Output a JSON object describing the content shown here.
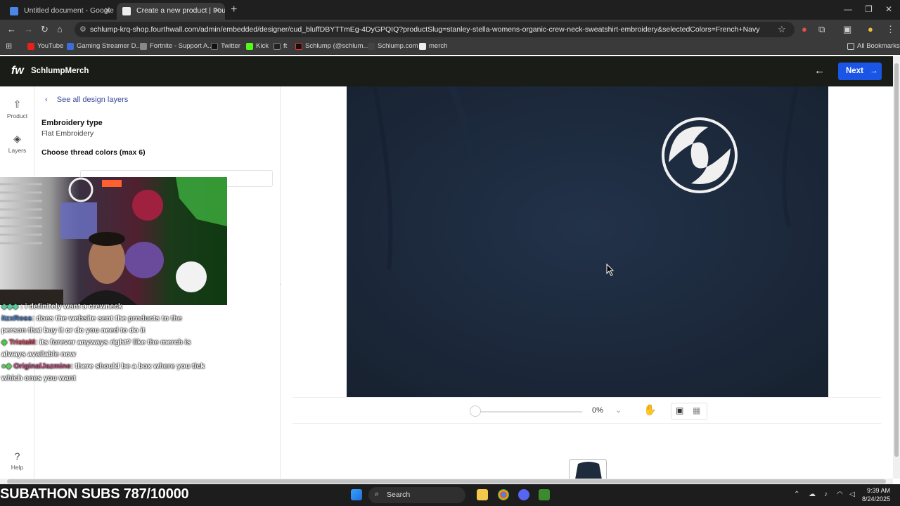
{
  "browser": {
    "tabs": [
      {
        "title": "Untitled document - Google Do",
        "active": false,
        "favicon": "docs-icon"
      },
      {
        "title": "Create a new product | Fourthw",
        "active": true,
        "favicon": "fourthwall-icon"
      }
    ],
    "url": "schlump-krq-shop.fourthwall.com/admin/embedded/designer/cud_bluffDBYTTmEg-4DyGPQIQ?productSlug=stanley-stella-womens-organic-crew-neck-sweatshirt-embroidery&selectedColors=French+Navy",
    "bookmarks": [
      "YouTube",
      "Gaming Streamer D...",
      "Fortnite - Support A...",
      "Twitter",
      "Kick",
      "ft",
      "Schlump (@schlum...",
      "Schlump.com",
      "merch"
    ],
    "all_bookmarks": "All Bookmarks"
  },
  "app": {
    "logo": "fw",
    "shop_name": "SchlumpMerch",
    "next_label": "Next",
    "accent": "#1a55e6"
  },
  "rail": {
    "product": "Product",
    "layers": "Layers",
    "help": "Help"
  },
  "panel": {
    "see_all": "See all design layers",
    "embroidery_type_label": "Embroidery type",
    "embroidery_type_value": "Flat Embroidery",
    "choose_colors": "Choose thread colors (max 6)"
  },
  "chat": [
    {
      "user": "",
      "text": ": i definitely want a crewneck"
    },
    {
      "user": "itzxRoss",
      "text": ": does the website sent the products to the person that buy it or do you need to do it"
    },
    {
      "user": "TristaM",
      "text": ": its forever anyways right? like the merch is always available now"
    },
    {
      "user": "OriginalJazmine",
      "text": ": there should be a box where you tick which ones you want"
    }
  ],
  "canvas": {
    "zoom": "0%",
    "shirt_color": "#1d2b3c"
  },
  "overlay": {
    "subathon": "SUBATHON SUBS 787/10000"
  },
  "taskbar": {
    "search": "Search",
    "time": "9:39 AM",
    "date": "8/24/2025"
  }
}
